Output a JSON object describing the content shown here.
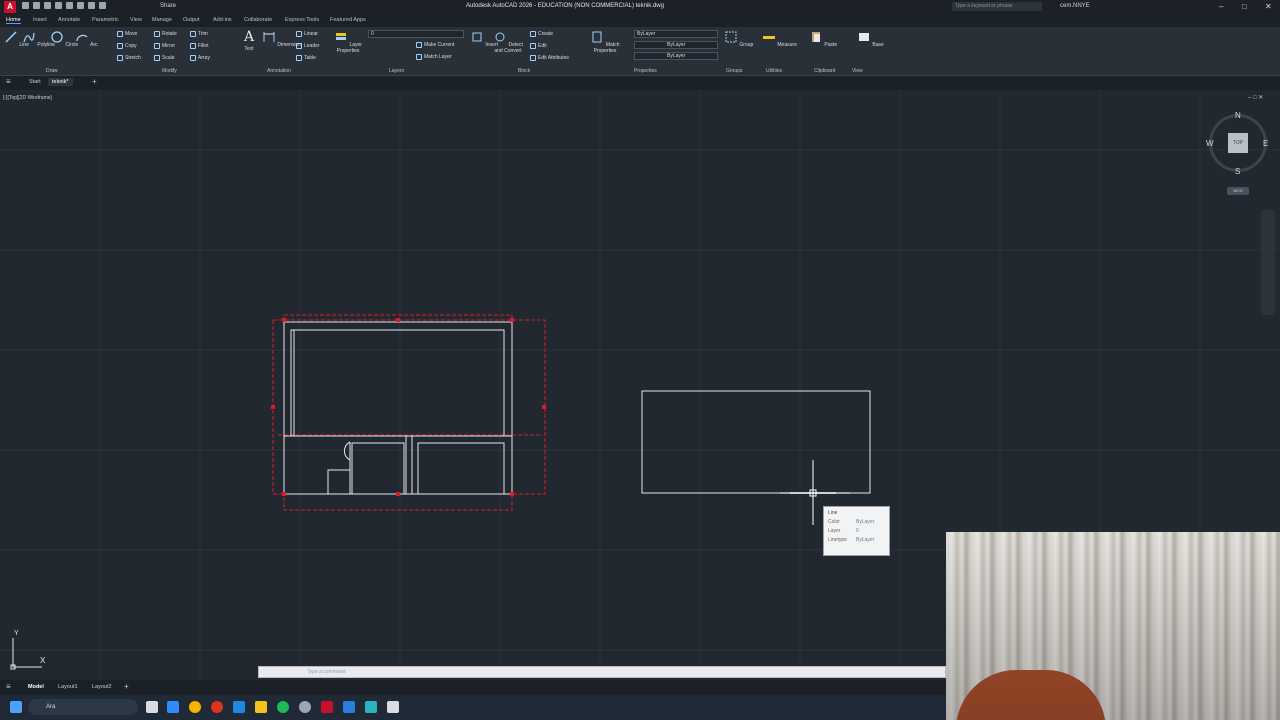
{
  "titlebar": {
    "app_logo": "A",
    "share_label": "Share",
    "title": "Autodesk AutoCAD 2026 - EDUCATION (NON COMMERCIAL)   teknik.dwg",
    "search_placeholder": "Type a keyword or phrase",
    "user": "cem.NNYE",
    "window_buttons": [
      "–",
      "□",
      "✕"
    ]
  },
  "ribbon_tabs": [
    "Home",
    "Insert",
    "Annotate",
    "Parametric",
    "View",
    "Manage",
    "Output",
    "Add-ins",
    "Collaborate",
    "Express Tools",
    "Featured Apps"
  ],
  "ribbon": {
    "draw": {
      "title": "Draw",
      "line": "Line",
      "polyline": "Polyline",
      "circle": "Circle",
      "arc": "Arc"
    },
    "modify": {
      "title": "Modify",
      "move": "Move",
      "rotate": "Rotate",
      "trim": "Trim",
      "copy": "Copy",
      "mirror": "Mirror",
      "fillet": "Fillet",
      "stretch": "Stretch",
      "scale": "Scale",
      "array": "Array"
    },
    "annotation": {
      "title": "Annotation",
      "text": "Text",
      "dimension": "Dimension",
      "linear": "Linear",
      "leader": "Leader",
      "table": "Table"
    },
    "layers": {
      "title": "Layers",
      "layer_properties": "Layer Properties",
      "make_current": "Make Current",
      "match_layer": "Match Layer",
      "current_layer": "0"
    },
    "block": {
      "title": "Block",
      "insert": "Insert",
      "detect_convert": "Detect and Convert",
      "create": "Create",
      "edit": "Edit",
      "edit_attributes": "Edit Attributes"
    },
    "properties": {
      "title": "Properties",
      "match_properties": "Match Properties",
      "color": "ByLayer",
      "lineweight": "ByLayer",
      "linetype": "ByLayer"
    },
    "groups": {
      "title": "Groups",
      "group": "Group"
    },
    "utilities": {
      "title": "Utilities",
      "measure": "Measure"
    },
    "clipboard": {
      "title": "Clipboard",
      "paste": "Paste"
    },
    "view": {
      "title": "View",
      "base": "Base"
    }
  },
  "file_tabs": {
    "start": "Start",
    "active": "teknik*",
    "add": "+"
  },
  "viewport": {
    "label": "[-][Top][2D Wireframe]",
    "viewcube": {
      "n": "N",
      "s": "S",
      "e": "E",
      "w": "W",
      "top": "TOP",
      "ucs": "WCS"
    },
    "ucs_x": "X",
    "ucs_y": "Y"
  },
  "tooltip": {
    "title": "Line",
    "rows": [
      {
        "key": "Color",
        "value": "ByLayer"
      },
      {
        "key": "Layer",
        "value": "0"
      },
      {
        "key": "Linetype",
        "value": "ByLayer"
      }
    ]
  },
  "command_line": {
    "placeholder": "Type a command"
  },
  "layout_tabs": [
    "Model",
    "Layout1",
    "Layout2"
  ],
  "taskbar": {
    "search_text": "Ara"
  },
  "colors": {
    "background": "#212830",
    "selection_red": "#d41c2a",
    "linework": "#e6e9ec",
    "accent": "#4aa3ff"
  }
}
